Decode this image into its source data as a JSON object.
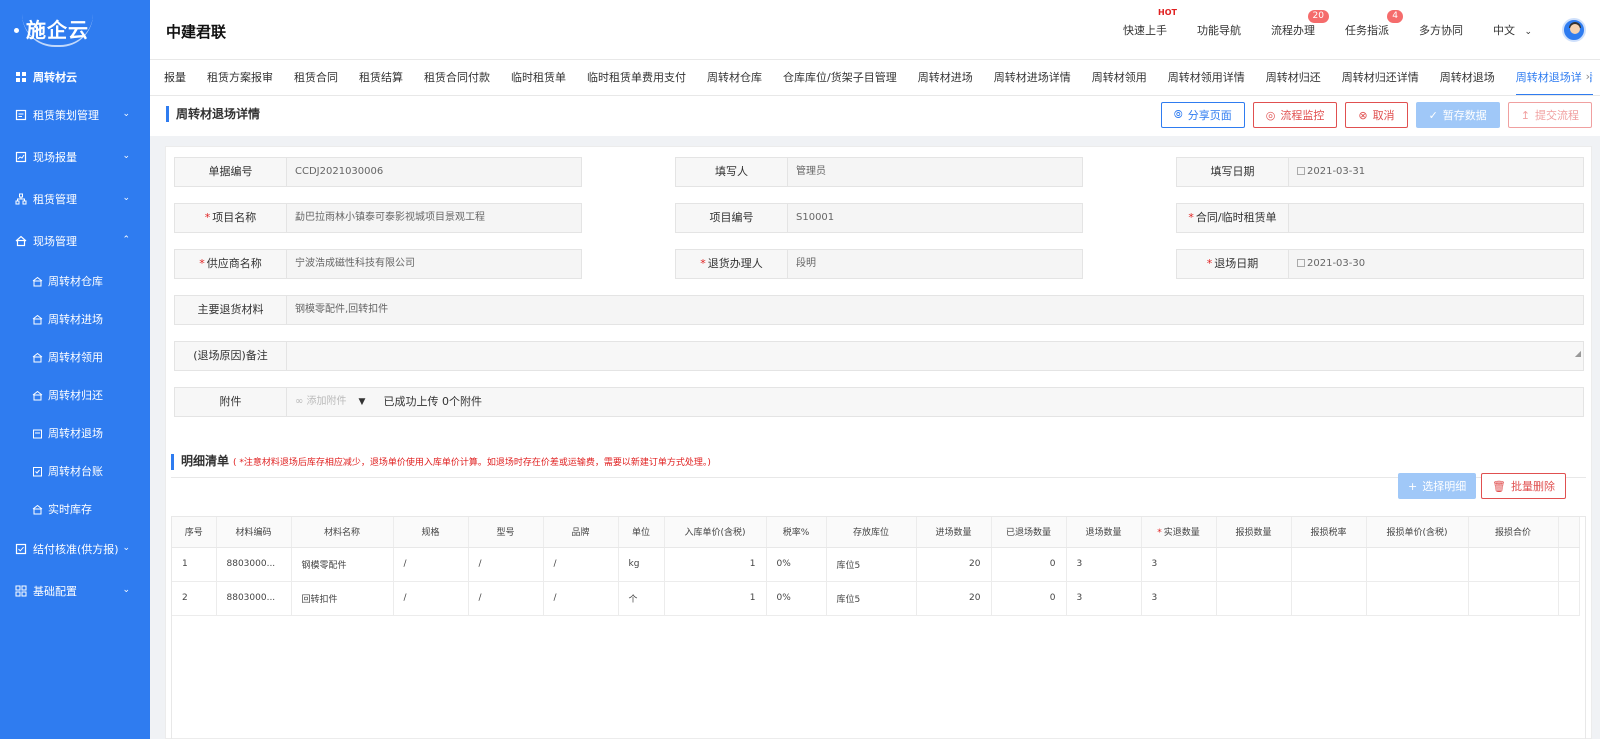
{
  "sidebar": {
    "logo": "施企云",
    "items": [
      {
        "label": "周转材云",
        "icon": "grid-icon"
      },
      {
        "label": "租赁策划管理",
        "icon": "clipboard-icon"
      },
      {
        "label": "现场报量",
        "icon": "chart-icon"
      },
      {
        "label": "租赁管理",
        "icon": "org-icon"
      },
      {
        "label": "现场管理",
        "icon": "house-icon"
      }
    ],
    "subitems": [
      "周转材仓库",
      "周转材进场",
      "周转材领用",
      "周转材归还",
      "周转材退场",
      "周转材台账",
      "实时库存"
    ],
    "bottom_items": [
      {
        "label": "结付核准(供方报)",
        "icon": "check-doc-icon"
      },
      {
        "label": "基础配置",
        "icon": "apps-icon"
      }
    ]
  },
  "header": {
    "brand": "中建君联",
    "nav": [
      {
        "label": "快速上手",
        "badge": "HOT"
      },
      {
        "label": "功能导航",
        "badge": ""
      },
      {
        "label": "流程办理",
        "badge": "20"
      },
      {
        "label": "任务指派",
        "badge": "4"
      },
      {
        "label": "多方协同",
        "badge": ""
      }
    ],
    "language": "中文"
  },
  "tabs": [
    "报量",
    "租赁方案报审",
    "租赁合同",
    "租赁结算",
    "租赁合同付款",
    "临时租赁单",
    "临时租赁单费用支付",
    "周转材仓库",
    "仓库库位/货架子目管理",
    "周转材进场",
    "周转材进场详情",
    "周转材领用",
    "周转材领用详情",
    "周转材归还",
    "周转材归还详情",
    "周转材退场",
    "周转材退场详情"
  ],
  "active_tab": "周转材退场详情",
  "page": {
    "title": "周转材退场详情",
    "buttons": {
      "share": "分享页面",
      "monitor": "流程监控",
      "cancel": "取消",
      "save": "暂存数据",
      "submit": "提交流程"
    }
  },
  "form": {
    "doc_no_label": "单据编号",
    "doc_no": "CCDJ2021030006",
    "filler_label": "填写人",
    "filler": "管理员",
    "fill_date_label": "填写日期",
    "fill_date": "2021-03-31",
    "project_name_label": "项目名称",
    "project_name": "勐巴拉雨林小镇泰可泰影视城项目景观工程",
    "project_no_label": "项目编号",
    "project_no": "S10001",
    "contract_label": "合同/临时租赁单",
    "contract": "",
    "supplier_label": "供应商名称",
    "supplier": "宁波浩成磁性科技有限公司",
    "handler_label": "退货办理人",
    "handler": "段明",
    "exit_date_label": "退场日期",
    "exit_date": "2021-03-30",
    "material_label": "主要退货材料",
    "material": "钢模零配件,回转扣件",
    "remark_label": "(退场原因)备注",
    "remark": "",
    "attach_label": "附件",
    "attach_btn": "添加附件",
    "attach_info": "已成功上传 0个附件"
  },
  "detail": {
    "title": "明细清单",
    "note": "( *注意材料退场后库存相应减少，退场单价使用入库单价计算。如退场时存在价差或运输费，需要以新建订单方式处理。)",
    "select_btn": "选择明细",
    "delete_btn": "批量删除",
    "columns": [
      "序号",
      "材料编码",
      "材料名称",
      "规格",
      "型号",
      "品牌",
      "单位",
      "入库单价(含税)",
      "税率%",
      "存放库位",
      "进场数量",
      "已退场数量",
      "退场数量",
      "实退数量",
      "报损数量",
      "报损税率",
      "报损单价(含税)",
      "报损合价"
    ],
    "rows": [
      [
        "1",
        "8803000...",
        "钢模零配件",
        "/",
        "/",
        "/",
        "kg",
        "1",
        "0%",
        "库位5",
        "20",
        "0",
        "3",
        "3",
        "",
        "",
        "",
        ""
      ],
      [
        "2",
        "8803000...",
        "回转扣件",
        "/",
        "/",
        "/",
        "个",
        "1",
        "0%",
        "库位5",
        "20",
        "0",
        "3",
        "3",
        "",
        "",
        "",
        ""
      ]
    ]
  }
}
